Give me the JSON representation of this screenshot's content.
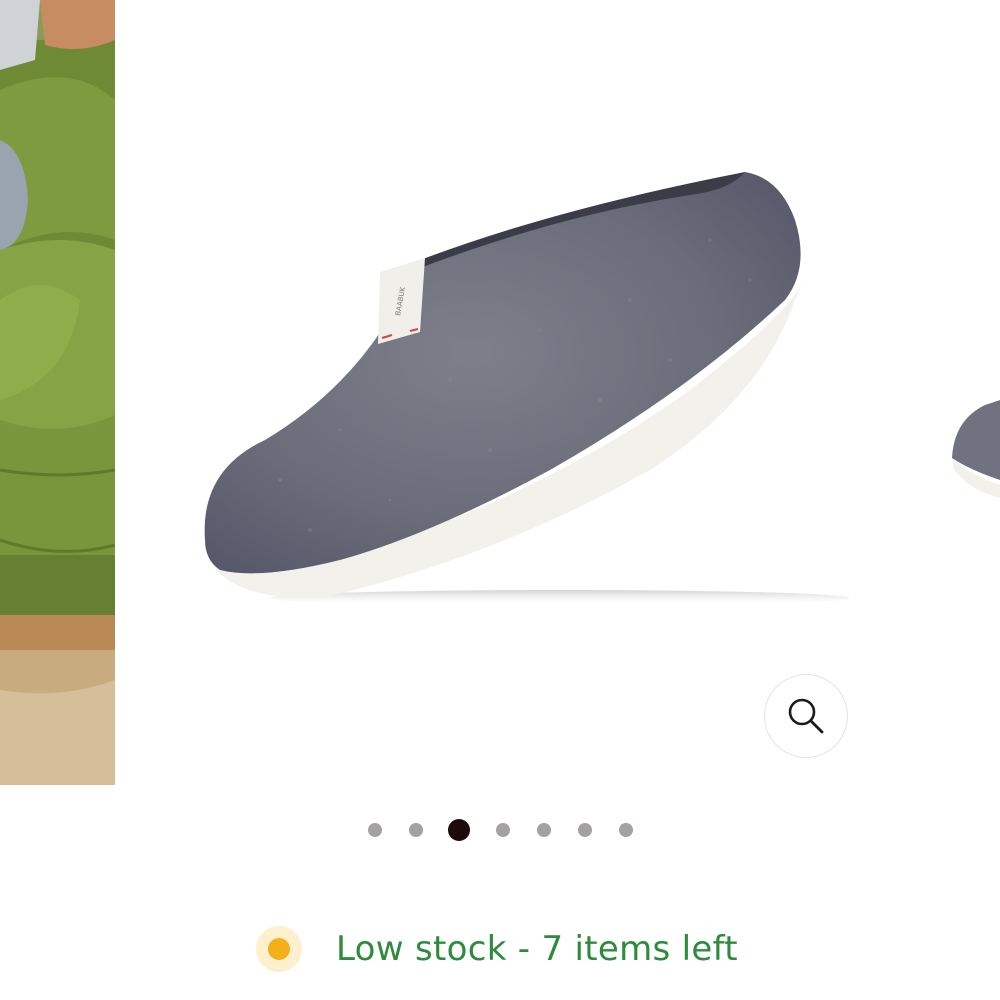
{
  "gallery": {
    "active_index": 2,
    "dot_count": 7,
    "slides": [
      {
        "name": "lifestyle-sofa-image"
      },
      {
        "name": "grey-felt-slipper-image",
        "brand_tag": "BAABUK"
      },
      {
        "name": "next-slipper-image"
      }
    ],
    "zoom_icon": "magnifier-icon"
  },
  "stock": {
    "text": "Low stock - 7 items left",
    "indicator_color": "#f3b018",
    "text_color": "#2e8b3c"
  }
}
